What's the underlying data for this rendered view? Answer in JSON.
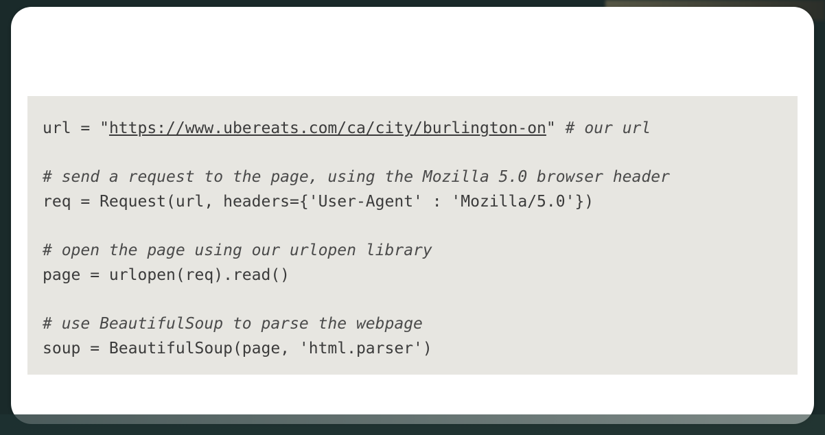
{
  "code": {
    "line1_prefix": "url = \"",
    "line1_url": "https://www.ubereats.com/ca/city/burlington-on",
    "line1_suffix": "\" ",
    "line1_comment": "# our url",
    "line2_blank": "",
    "line3_comment": "# send a request to the page, using the Mozilla 5.0 browser header",
    "line4": "req = Request(url, headers={'User-Agent' : 'Mozilla/5.0'})",
    "line5_blank": "",
    "line6_comment": "# open the page using our urlopen library",
    "line7": "page = urlopen(req).read()",
    "line8_blank": "",
    "line9_comment": "# use BeautifulSoup to parse the webpage",
    "line10": "soup = BeautifulSoup(page, 'html.parser')"
  }
}
